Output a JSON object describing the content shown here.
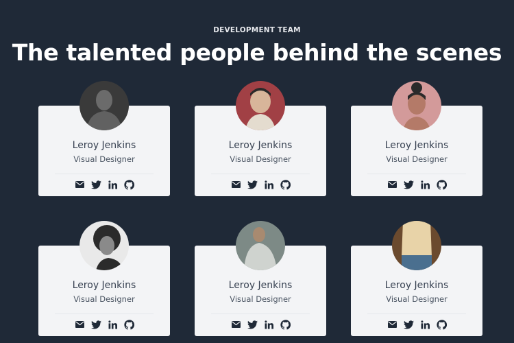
{
  "header": {
    "eyebrow": "DEVELOPMENT TEAM",
    "title": "The talented people behind the scenes"
  },
  "members": [
    {
      "name": "Leroy Jenkins",
      "role": "Visual Designer",
      "avatar_bg": "#3a3a3a",
      "avatar_fg": "#6b6b6b"
    },
    {
      "name": "Leroy Jenkins",
      "role": "Visual Designer",
      "avatar_bg": "#a14045",
      "avatar_fg": "#d8b59a"
    },
    {
      "name": "Leroy Jenkins",
      "role": "Visual Designer",
      "avatar_bg": "#d39a9a",
      "avatar_fg": "#b47a68"
    },
    {
      "name": "Leroy Jenkins",
      "role": "Visual Designer",
      "avatar_bg": "#e9e9e9",
      "avatar_fg": "#2b2b2b"
    },
    {
      "name": "Leroy Jenkins",
      "role": "Visual Designer",
      "avatar_bg": "#7d8a86",
      "avatar_fg": "#cfd3cf"
    },
    {
      "name": "Leroy Jenkins",
      "role": "Visual Designer",
      "avatar_bg": "#6b4a2e",
      "avatar_fg": "#e8d3a8"
    }
  ],
  "socials": [
    "mail-icon",
    "twitter-icon",
    "linkedin-icon",
    "github-icon"
  ],
  "colors": {
    "page_bg": "#1f2937",
    "card_bg": "#f3f4f6",
    "text": "#374151"
  }
}
